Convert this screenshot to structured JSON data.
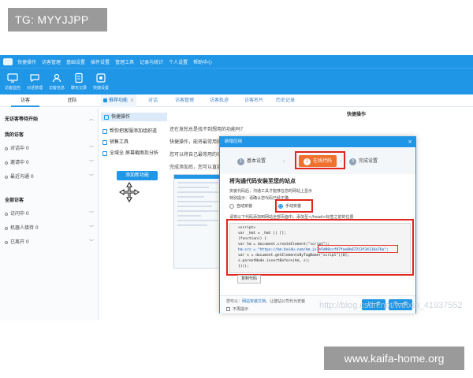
{
  "watermarks": {
    "top_left": "TG: MYYJJPP",
    "bottom_right": "www.kaifa-home.org",
    "blog": "http://blog.csdn.net/weixin_41937552"
  },
  "colors": {
    "brand": "#1f96e6",
    "step_active": "#f0712c",
    "highlight_box": "#e0261c"
  },
  "menubar": {
    "items": [
      "快捷操作",
      "访客管理",
      "基础设置",
      "插件设置",
      "管理工具",
      "记录与统计",
      "个人设置",
      "帮助中心"
    ]
  },
  "toolbar": {
    "tools": [
      {
        "icon": "monitor-icon",
        "label": "访客监控"
      },
      {
        "icon": "chat-icon",
        "label": "对话管理"
      },
      {
        "icon": "user-icon",
        "label": "访客信息"
      },
      {
        "icon": "record-icon",
        "label": "聊天记录"
      },
      {
        "icon": "settings-icon",
        "label": "快捷设置"
      }
    ]
  },
  "left_tabs": [
    {
      "label": "访客",
      "active": true
    },
    {
      "label": "团队",
      "active": false
    }
  ],
  "top_tabs": [
    {
      "label": "推荐功能",
      "active": true,
      "closable": "×"
    },
    {
      "label": "对话",
      "active": false
    },
    {
      "label": "访客管理",
      "active": false
    },
    {
      "label": "访客轨迹",
      "active": false
    },
    {
      "label": "访客名片",
      "active": false
    },
    {
      "label": "历史记录",
      "active": false
    }
  ],
  "sidebar": {
    "sections": [
      {
        "title": "无访客等待开始",
        "items": []
      },
      {
        "title": "我的访客",
        "items": [
          "对话中 0",
          "邀请中 0",
          "最近沟通 0"
        ]
      },
      {
        "title": "全部访客",
        "items": [
          "访问中 0",
          "机器人接待 0",
          "已离开 0"
        ]
      }
    ]
  },
  "quick_panel": {
    "items": [
      "快捷操作",
      "帮你把客服添加组织道",
      "销售工具",
      "全域全",
      "屏幕截图及分析"
    ],
    "add_button": "添加新功能"
  },
  "main": {
    "title": "快捷操作",
    "intro_lines": [
      "还在发愁总是找不到想用的功能吗？",
      "快捷操作，能将最常用的功能放在这里",
      "您可以将自己最常用的功能",
      "完成添加后，您可以直接使用"
    ]
  },
  "dialog": {
    "title": "新增应用",
    "close": "×",
    "steps": [
      {
        "num": "1",
        "label": "基本设置"
      },
      {
        "num": "2",
        "label": "在线代码"
      },
      {
        "num": "3",
        "label": "完成设置"
      }
    ],
    "heading": "将沟通代码安装至您的站点",
    "desc1": "安装代码后，沟通工具才能够在您的网站上显示",
    "desc2": "特别提示：请确认您代码已经正确",
    "radio_auto": "自动安装",
    "radio_manual": "手动安装",
    "code_hint": "请将以下代码添加到网站全部页面中，添加至</head>标签之前的位置",
    "code_lines": [
      "<script>",
      "var _hmt = _hmt || [];",
      "(function() {",
      "  var hm = document.createElement(\"script\");",
      "  hm.src = \"https://hm.baidu.com/hm.js?b5d00ccf97fae0b67213f34116a76a\";",
      "  var s = document.getElementsByTagName(\"script\")[0];",
      "  s.parentNode.insertBefore(hm, s);",
      "})();"
    ],
    "copy_button": "复制代码",
    "footer_text": "您可以：",
    "footer_link": "网站安装文档",
    "footer_suffix": "，让建站公司代为安装",
    "footer_check": "不再提示",
    "btn_prev": "上一步",
    "btn_next": "下一步"
  }
}
